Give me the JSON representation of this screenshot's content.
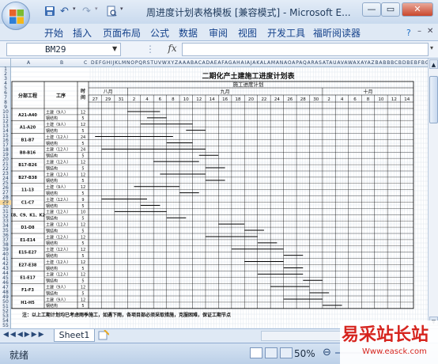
{
  "window": {
    "title": "周进度计划表格模板  [兼容模式] - Microsoft E...",
    "minimize": "—",
    "restore": "▭",
    "close": "✕"
  },
  "ribbon": {
    "tabs": [
      "开始",
      "插入",
      "页面布局",
      "公式",
      "数据",
      "审阅",
      "视图",
      "开发工具",
      "福昕阅读器"
    ]
  },
  "formula_bar": {
    "name_box": "BM29",
    "fx": "fx",
    "content": ""
  },
  "sheet": {
    "title": "二期化产土建施工进度计划表",
    "subtitle": "施工进度计划",
    "col_headers_left": [
      "A",
      "B",
      "C"
    ],
    "col_headers_right": "DEFGHIJKLMNOPQRSTUVWXYZAAABACADAEAFAGAHAIAJAKALAMANAOAPAQARASATAUAVAWAXAYAZBABBBCBDBEBFBGBHBIBJBKBLBMBNBOBPBQBRBSBT",
    "row_numbers": [
      "1",
      "2",
      "3",
      "4",
      "5",
      "6",
      "7",
      "8",
      "9",
      "10",
      "11",
      "12",
      "13",
      "14",
      "15",
      "16",
      "17",
      "18",
      "19",
      "20",
      "21",
      "22",
      "23",
      "24",
      "25",
      "26",
      "27",
      "28",
      "29",
      "30",
      "31",
      "32",
      "33",
      "34",
      "35",
      "36",
      "37",
      "38",
      "39",
      "40",
      "41",
      "42",
      "43",
      "44",
      "45",
      "46",
      "47",
      "48",
      "49",
      "50",
      "51",
      "52",
      "53",
      "54",
      "55"
    ],
    "header_labels": {
      "section": "分部工程",
      "work": "工序",
      "time": "时间"
    },
    "months": [
      "八月",
      "九月",
      "十月"
    ],
    "days": [
      "27",
      "29",
      "31",
      "2",
      "4",
      "6",
      "8",
      "10",
      "12",
      "14",
      "16",
      "18",
      "20",
      "22",
      "24",
      "26",
      "28",
      "30",
      "2",
      "4",
      "6",
      "8",
      "10",
      "12",
      "14"
    ],
    "sections": [
      "A21-A40",
      "A1-A20",
      "B1-B7",
      "B8-B16",
      "B17-B26",
      "B27-B38",
      "11-13",
      "C1-C7",
      "C8、C9、K1、K2",
      "D1-D8",
      "E1-E14",
      "E15-E27",
      "E27-E38",
      "E1-E17",
      "F1-F3",
      "H1-H5"
    ],
    "tasks": [
      {
        "name": "土建（9人）",
        "days": "12"
      },
      {
        "name": "钢结构",
        "days": "5"
      },
      {
        "name": "土建（9人）",
        "days": "12"
      },
      {
        "name": "钢结构",
        "days": "5"
      },
      {
        "name": "土建（12人）",
        "days": "24"
      },
      {
        "name": "钢结构",
        "days": "5"
      },
      {
        "name": "土建（12人）",
        "days": "24"
      },
      {
        "name": "钢结构",
        "days": "5"
      },
      {
        "name": "土建（12人）",
        "days": "12"
      },
      {
        "name": "钢结构",
        "days": "5"
      },
      {
        "name": "土建（12人）",
        "days": "12"
      },
      {
        "name": "钢结构",
        "days": "5"
      },
      {
        "name": "土建（9人）",
        "days": "12"
      },
      {
        "name": "钢结构",
        "days": "5"
      },
      {
        "name": "土建（12人）",
        "days": "9"
      },
      {
        "name": "钢结构",
        "days": "5"
      },
      {
        "name": "土建（12人）",
        "days": "10"
      },
      {
        "name": "钢结构",
        "days": "5"
      },
      {
        "name": "土建（12人）",
        "days": "12"
      },
      {
        "name": "钢结构",
        "days": "5"
      },
      {
        "name": "土建（12人）",
        "days": "12"
      },
      {
        "name": "钢结构",
        "days": "5"
      },
      {
        "name": "土建（12人）",
        "days": "12"
      },
      {
        "name": "钢结构",
        "days": "5"
      },
      {
        "name": "土建（12人）",
        "days": "12"
      },
      {
        "name": "钢结构",
        "days": "5"
      },
      {
        "name": "土建（12人）",
        "days": "12"
      },
      {
        "name": "钢结构",
        "days": "5"
      },
      {
        "name": "土建（9人）",
        "days": "12"
      },
      {
        "name": "钢结构",
        "days": "5"
      },
      {
        "name": "土建（9人）",
        "days": "12"
      },
      {
        "name": "钢结构",
        "days": "5"
      }
    ],
    "note": "注：以上工期计划均已考虑雨季施工，如遇下雨，各项目部必须采取措施，克服困难，保证工期节点"
  },
  "sheet_tabs": [
    "Sheet1"
  ],
  "status": {
    "ready": "就绪",
    "zoom": "50%"
  },
  "watermark": {
    "text": "易采站长站",
    "url": "Www.easck.com"
  }
}
